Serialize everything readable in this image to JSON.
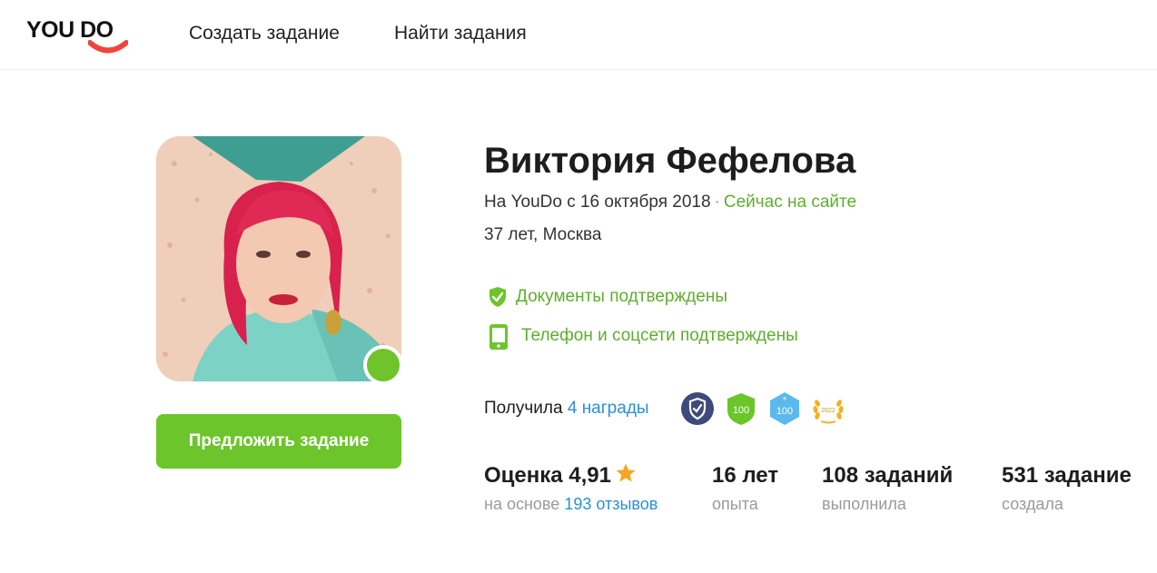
{
  "header": {
    "logo": "YOU DO",
    "nav": {
      "create_task": "Создать задание",
      "find_tasks": "Найти задания"
    }
  },
  "profile": {
    "name": "Виктория Фефелова",
    "since": "На YouDo с 16 октября 2018",
    "separator": "·",
    "online_status": "Сейчас на сайте",
    "age_city": "37 лет, Москва",
    "verifications": {
      "documents": "Документы подтверждены",
      "phone": "Телефон и соцсети подтверждены"
    },
    "offer_button": "Предложить задание"
  },
  "awards": {
    "label": "Получила",
    "link": "4 награды",
    "badges": [
      {
        "icon": "shield-check-badge-icon",
        "color": "#3d4a7a"
      },
      {
        "icon": "100-green-badge-icon",
        "text": "100",
        "color": "#6cc52a"
      },
      {
        "icon": "100-plus-blue-badge-icon",
        "text": "100",
        "color": "#5bb9ee"
      },
      {
        "icon": "laurel-2022-badge-icon",
        "text": "2022",
        "color": "#f2b21f"
      }
    ]
  },
  "stats": {
    "rating": {
      "value": "Оценка 4,91",
      "sub_prefix": "на основе",
      "reviews_link": "193 отзывов"
    },
    "experience": {
      "value": "16 лет",
      "sub": "опыта"
    },
    "completed": {
      "value": "108 заданий",
      "sub": "выполнила"
    },
    "created": {
      "value": "531 задание",
      "sub": "создала"
    }
  },
  "colors": {
    "brand_green": "#6cc52a",
    "link_blue": "#2b8fd8",
    "logo_red": "#f0453b",
    "star_orange": "#f5a623"
  }
}
